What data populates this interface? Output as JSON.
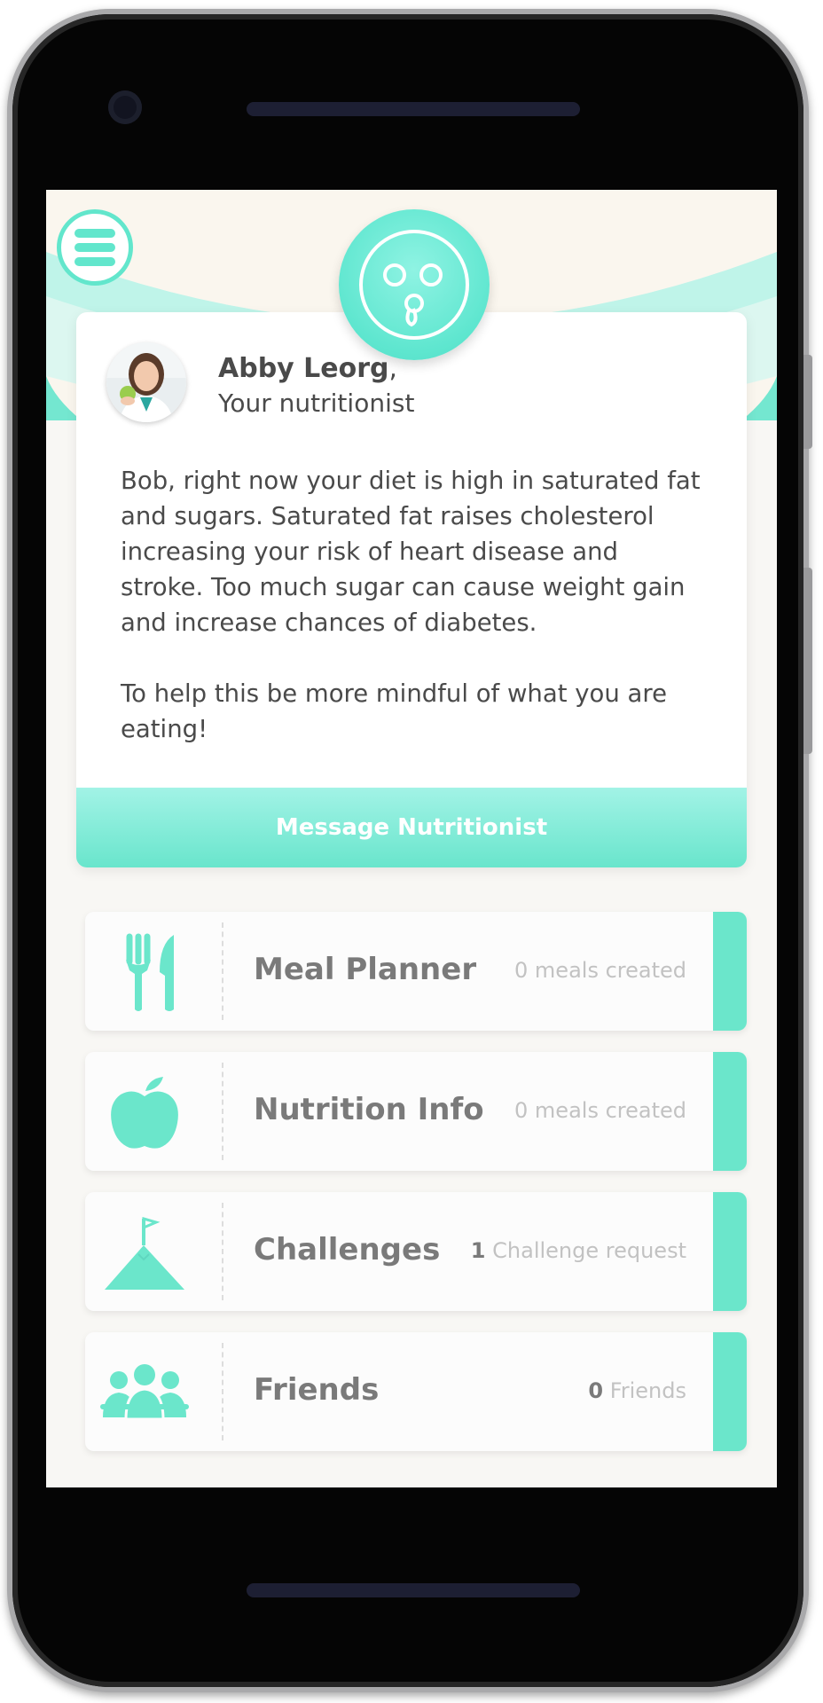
{
  "nutritionist": {
    "name": "Abby Leorg",
    "comma": ",",
    "role": "Your nutritionist"
  },
  "message": {
    "paragraph1": "Bob, right now your diet is high in saturated fat and sugars. Saturated fat raises cholesterol increasing your risk of heart disease and stroke. Too much sugar can cause weight gain and increase chances of diabetes.",
    "paragraph2": "To help this be more mindful of what you are eating!"
  },
  "actions": {
    "message_button": "Message Nutritionist"
  },
  "rows": [
    {
      "title": "Meal Planner",
      "count": "",
      "meta": "0 meals created",
      "icon": "cutlery-icon"
    },
    {
      "title": "Nutrition Info",
      "count": "",
      "meta": "0 meals created",
      "icon": "apple-icon"
    },
    {
      "title": "Challenges",
      "count": "1",
      "meta": "Challenge request",
      "icon": "mountain-flag-icon"
    },
    {
      "title": "Friends",
      "count": "0",
      "meta": "Friends",
      "icon": "friends-group-icon"
    }
  ],
  "colors": {
    "accent": "#6be6cb",
    "text": "#4a4a4a",
    "muted": "#c2c2c2"
  }
}
